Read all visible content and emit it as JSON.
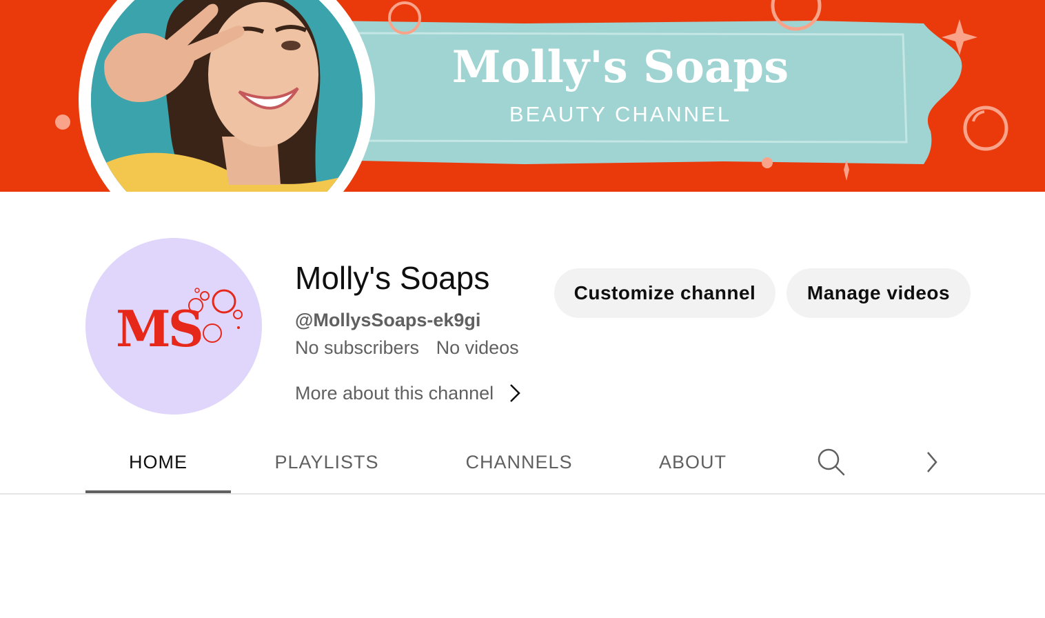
{
  "banner": {
    "title": "Molly's Soaps",
    "subtitle": "BEAUTY CHANNEL",
    "colors": {
      "background": "#ea3a0c",
      "label": "#a0d4d2"
    },
    "photo": "smiling-woman-peace-sign-photo"
  },
  "channel": {
    "avatar_text": "MS",
    "avatar_colors": {
      "background": "#e0d6fb",
      "text": "#e5281a"
    },
    "name": "Molly's Soaps",
    "handle": "@MollysSoaps-ek9gi",
    "subscribers": "No subscribers",
    "videos": "No videos",
    "more_about": "More about this channel",
    "more_about_icon": "chevron-right-icon"
  },
  "actions": {
    "customize_label": "Customize channel",
    "manage_label": "Manage videos"
  },
  "tabs": [
    {
      "label": "HOME",
      "active": true
    },
    {
      "label": "PLAYLISTS",
      "active": false
    },
    {
      "label": "CHANNELS",
      "active": false
    },
    {
      "label": "ABOUT",
      "active": false
    }
  ],
  "tab_icons": {
    "search": "search-icon",
    "next": "chevron-right-icon"
  }
}
